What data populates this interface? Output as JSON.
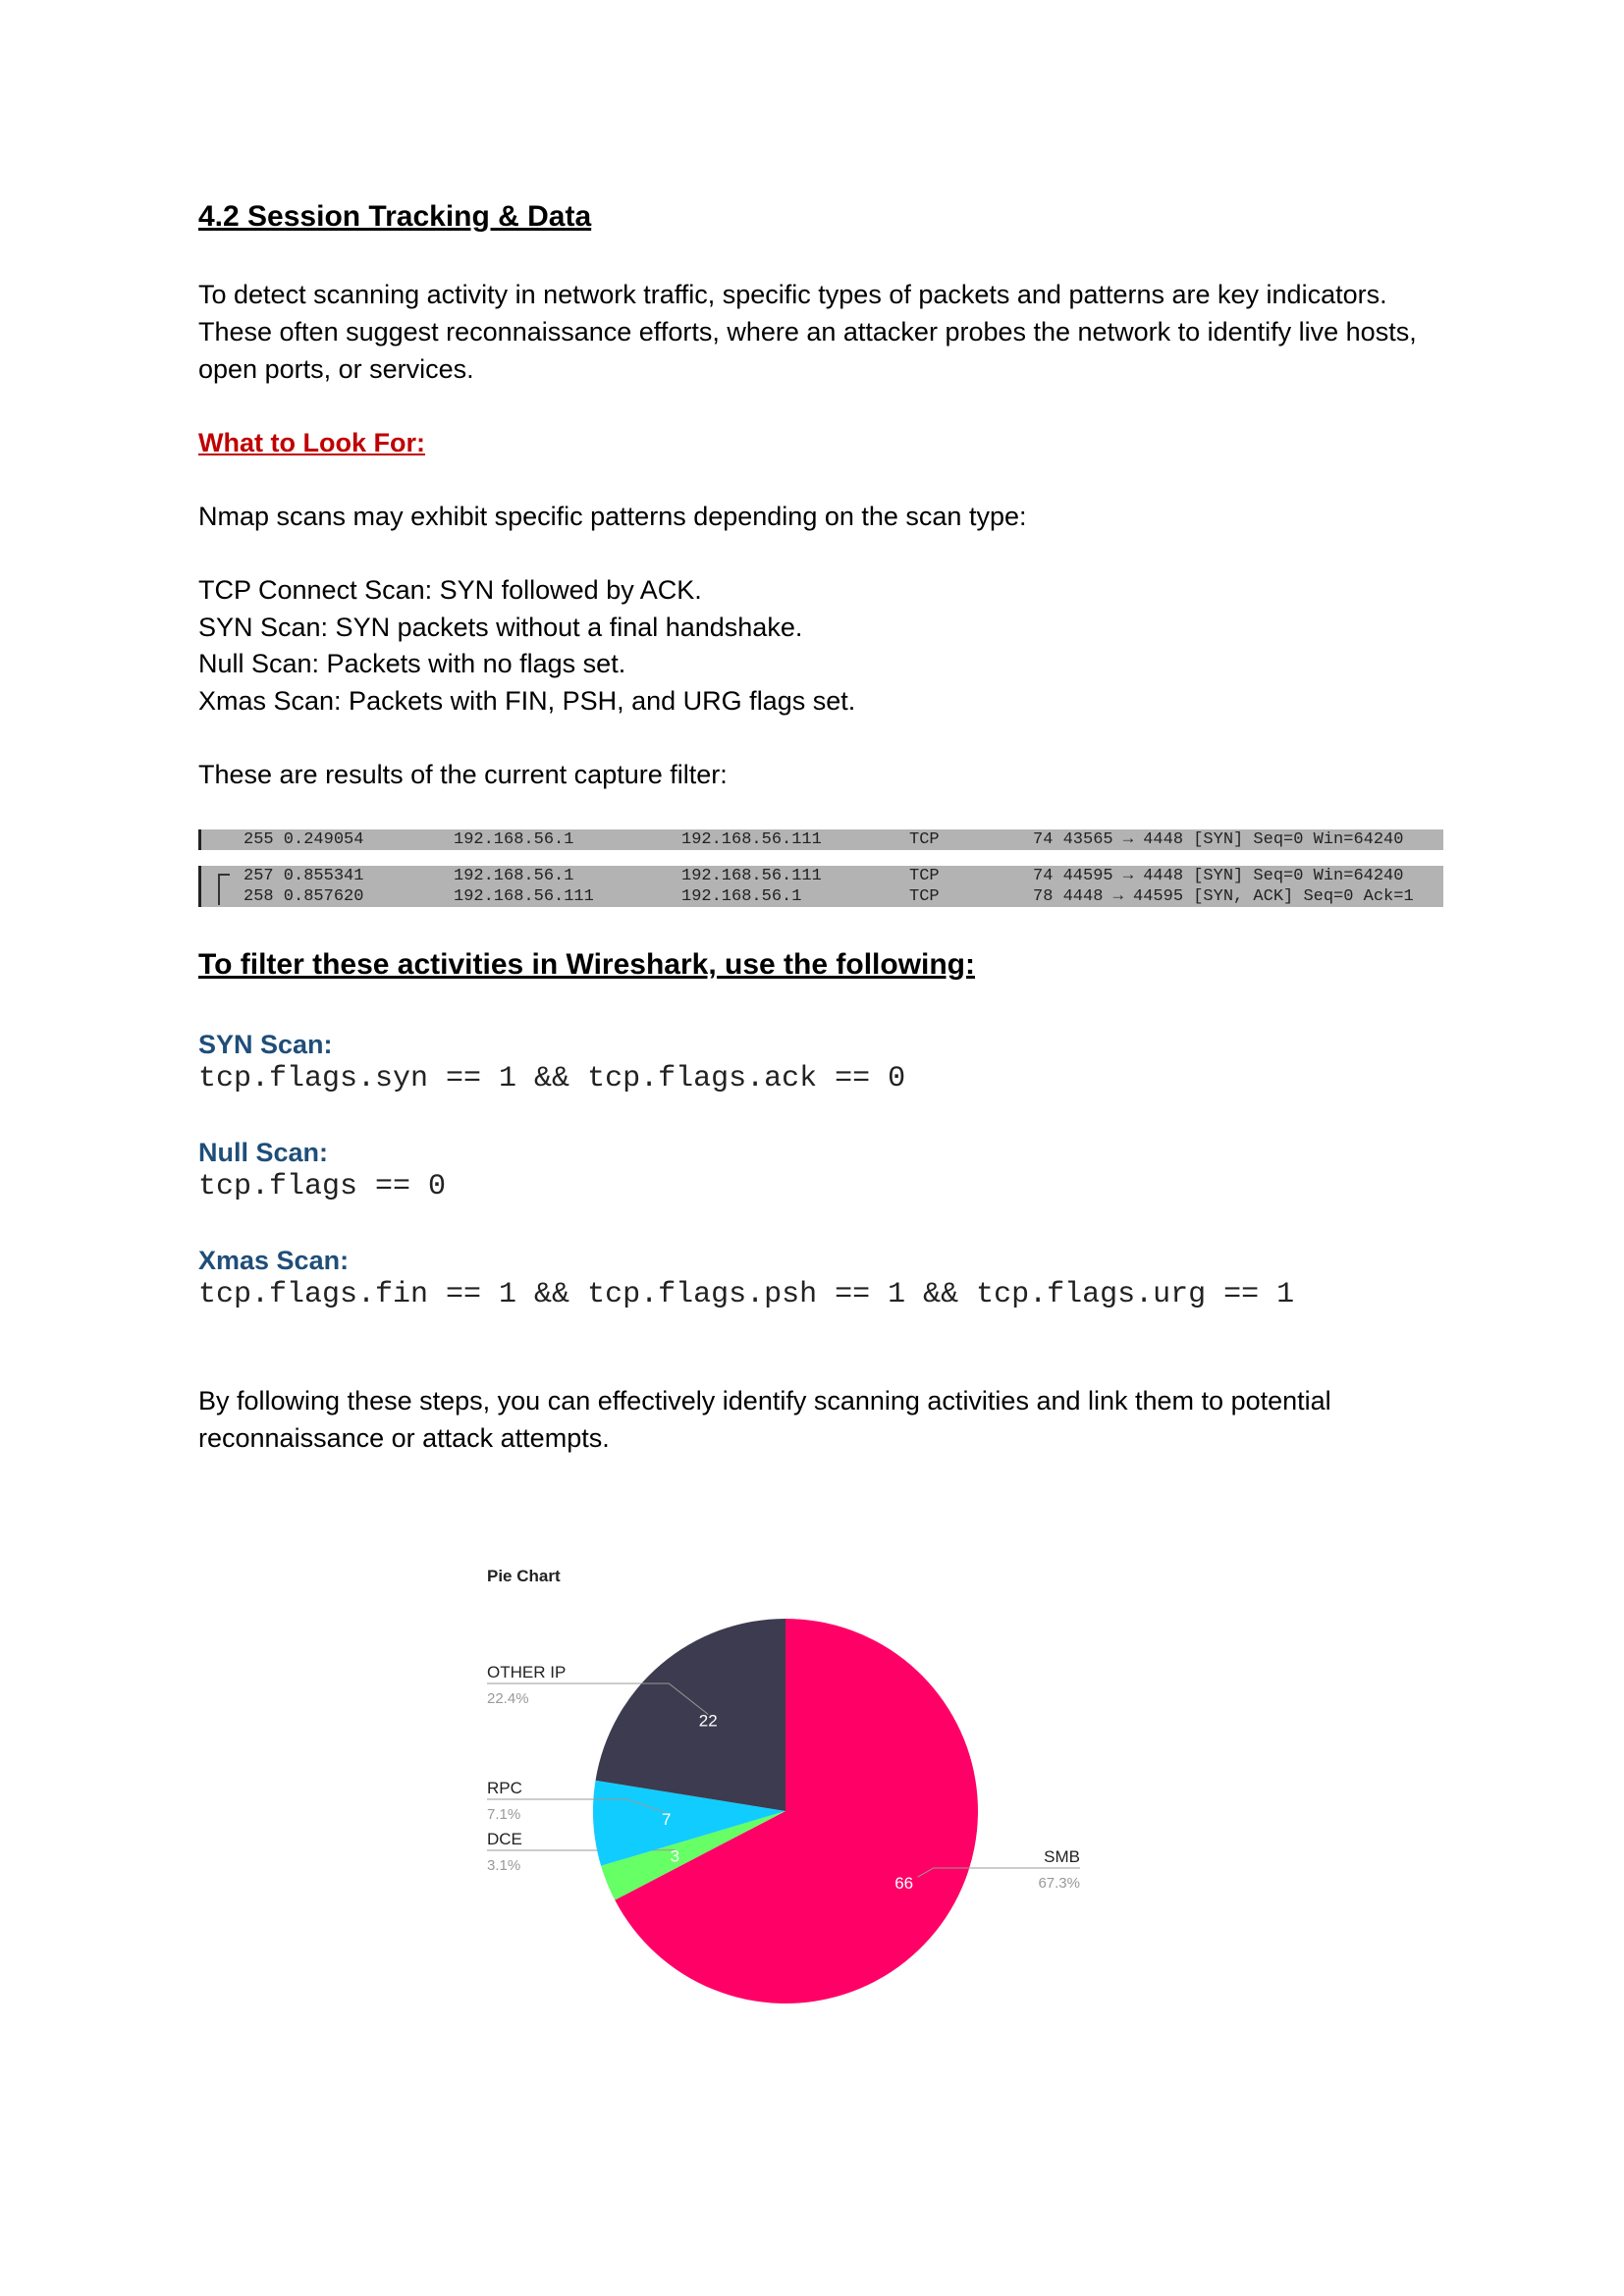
{
  "section_title": "4.2 Session Tracking & Data",
  "intro": "To detect scanning activity in network traffic, specific types of packets and patterns are key indicators. These often suggest reconnaissance efforts, where an attacker probes the network to identify live hosts, open ports, or services.",
  "what_to_look_for": "What to Look For:",
  "nmap_intro": "Nmap scans may exhibit specific patterns depending on the scan type:",
  "scan_types": [
    "TCP Connect Scan: SYN followed by ACK.",
    "SYN Scan: SYN packets without a final handshake.",
    "Null Scan: Packets with no flags set.",
    "Xmas Scan: Packets with FIN, PSH, and URG flags set."
  ],
  "capture_intro": "These are results of the current capture filter:",
  "capture_rows": [
    {
      "no": "255 0.249054",
      "src": "192.168.56.1",
      "dst": "192.168.56.111",
      "proto": "TCP",
      "info": "74 43565 → 4448 [SYN] Seq=0 Win=64240"
    },
    {
      "no": "257 0.855341",
      "src": "192.168.56.1",
      "dst": "192.168.56.111",
      "proto": "TCP",
      "info": "74 44595 → 4448 [SYN] Seq=0 Win=64240"
    },
    {
      "no": "258 0.857620",
      "src": "192.168.56.111",
      "dst": "192.168.56.1",
      "proto": "TCP",
      "info": "78 4448 → 44595 [SYN, ACK] Seq=0 Ack=1"
    }
  ],
  "filter_heading": "To filter these activities in Wireshark, use the following:",
  "filters": [
    {
      "name": "SYN Scan:",
      "expr": "tcp.flags.syn == 1 && tcp.flags.ack == 0"
    },
    {
      "name": "Null Scan:",
      "expr": "tcp.flags == 0"
    },
    {
      "name": "Xmas Scan:",
      "expr": "tcp.flags.fin == 1 && tcp.flags.psh == 1 && tcp.flags.urg == 1"
    }
  ],
  "conclusion": "By following these steps, you can effectively identify scanning activities and link them to potential reconnaissance or attack attempts.",
  "chart_data": {
    "type": "pie",
    "title": "Pie Chart",
    "slices": [
      {
        "label": "SMB",
        "value": 66,
        "percent": "67.3%",
        "color": "#ff0066"
      },
      {
        "label": "DCE",
        "value": 3,
        "percent": "3.1%",
        "color": "#66ff66"
      },
      {
        "label": "RPC",
        "value": 7,
        "percent": "7.1%",
        "color": "#11ccff"
      },
      {
        "label": "OTHER IP",
        "value": 22,
        "percent": "22.4%",
        "color": "#3d3b4f"
      }
    ]
  }
}
